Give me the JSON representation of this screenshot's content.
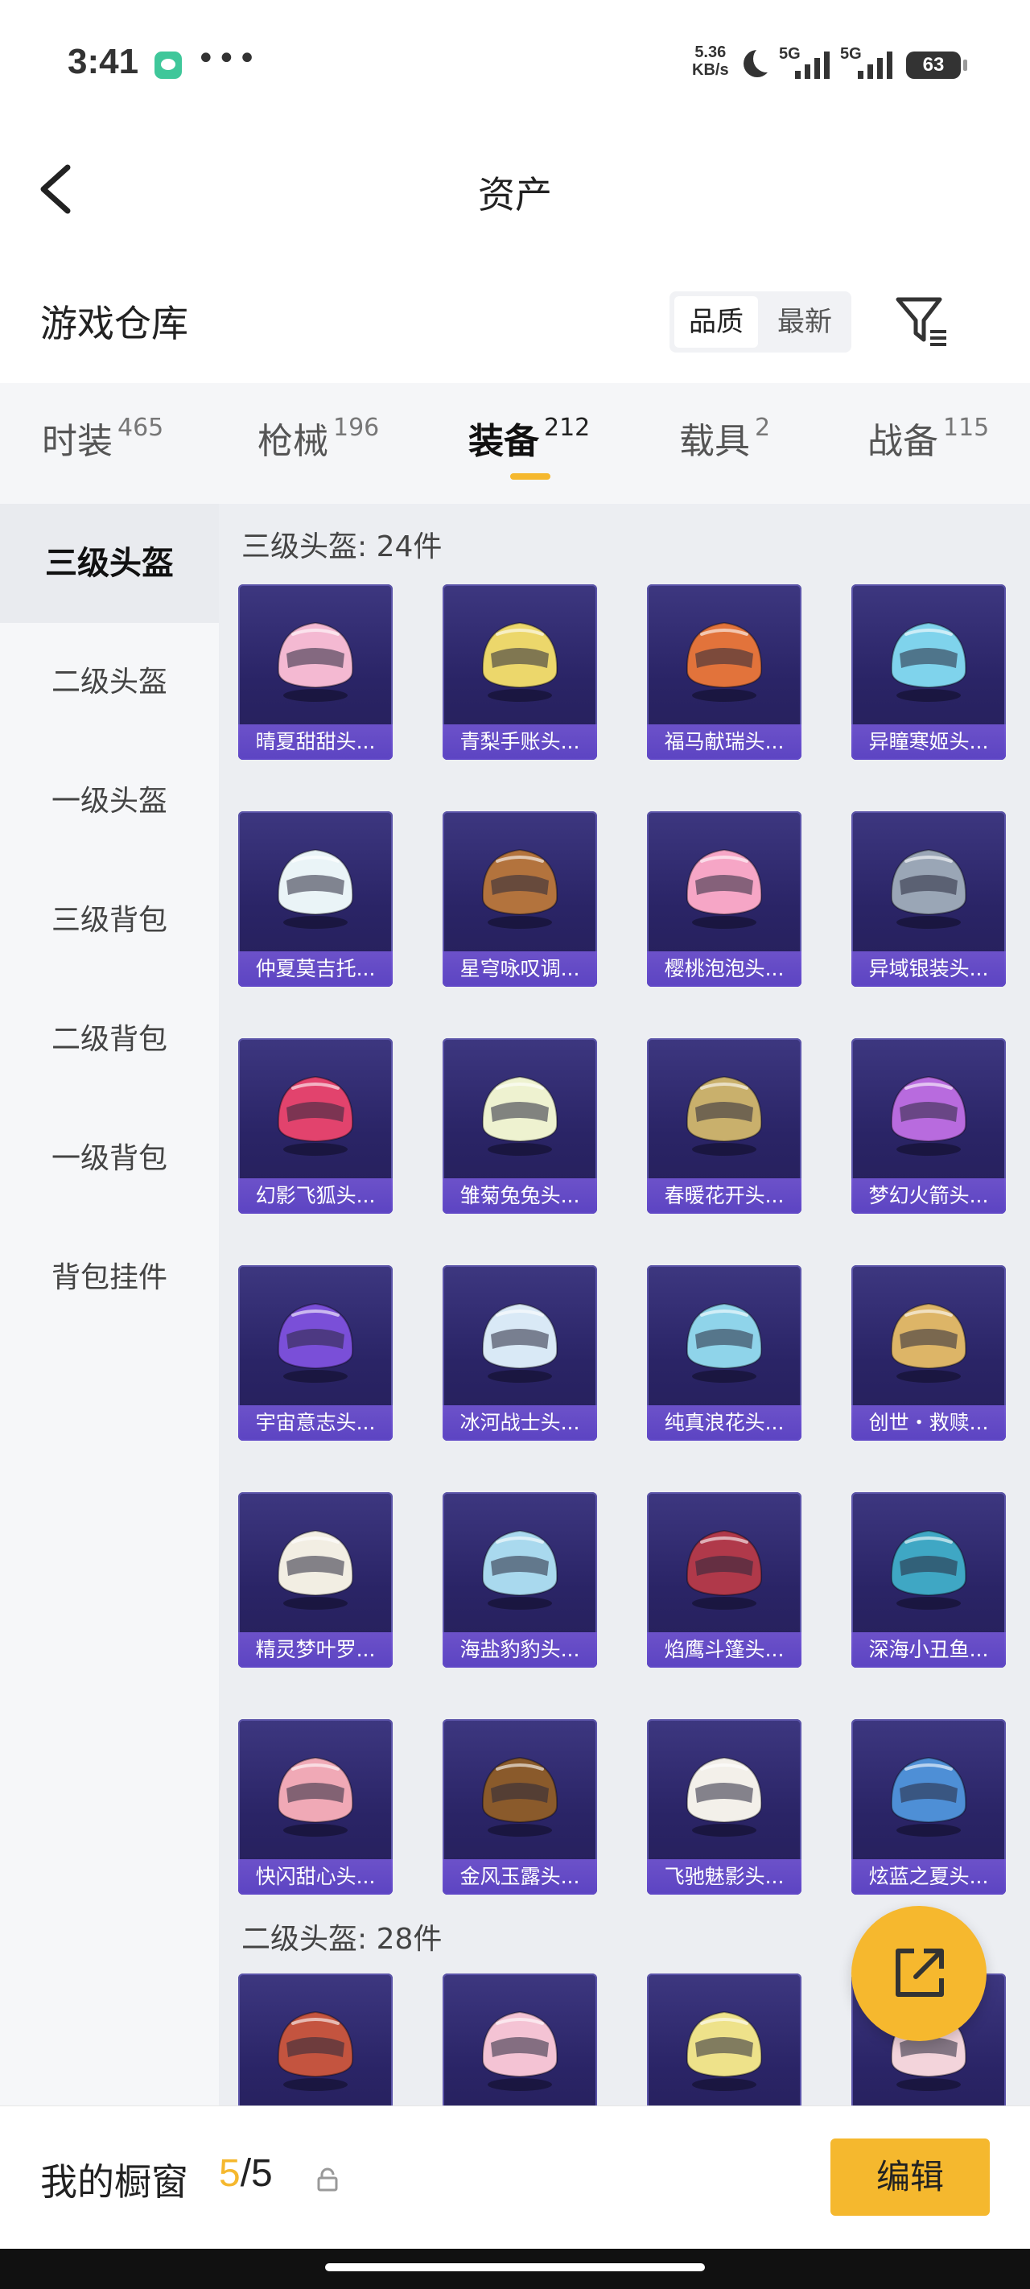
{
  "status_bar": {
    "time": "3:41",
    "net_speed_value": "5.36",
    "net_speed_unit": "KB/s",
    "sim1": "5G",
    "sim2": "5G",
    "battery": "63"
  },
  "header": {
    "title": "资产"
  },
  "warehouse": {
    "title": "游戏仓库",
    "sort_options": [
      "品质",
      "最新"
    ],
    "selected_sort": "品质"
  },
  "tabs": [
    {
      "label": "时装",
      "count": "465"
    },
    {
      "label": "枪械",
      "count": "196"
    },
    {
      "label": "装备",
      "count": "212",
      "active": true
    },
    {
      "label": "载具",
      "count": "2"
    },
    {
      "label": "战备",
      "count": "115"
    }
  ],
  "sidebar": [
    "三级头盔",
    "二级头盔",
    "一级头盔",
    "三级背包",
    "二级背包",
    "一级背包",
    "背包挂件"
  ],
  "sections": [
    {
      "title": "三级头盔: 24件",
      "items": [
        {
          "name": "晴夏甜甜头...",
          "color": "#f4b9d2"
        },
        {
          "name": "青梨手账头...",
          "color": "#ecd76b"
        },
        {
          "name": "福马献瑞头...",
          "color": "#e2733b"
        },
        {
          "name": "异瞳寒姬头...",
          "color": "#7fd3ec"
        },
        {
          "name": "仲夏莫吉托...",
          "color": "#eaf4f7"
        },
        {
          "name": "星穹咏叹调...",
          "color": "#b3733d"
        },
        {
          "name": "樱桃泡泡头...",
          "color": "#f6a6c6"
        },
        {
          "name": "异域银装头...",
          "color": "#9aa6b6"
        },
        {
          "name": "幻影飞狐头...",
          "color": "#e2436d"
        },
        {
          "name": "雏菊兔兔头...",
          "color": "#eef2d0"
        },
        {
          "name": "春暖花开头...",
          "color": "#c9b06c"
        },
        {
          "name": "梦幻火箭头...",
          "color": "#b86bde"
        },
        {
          "name": "宇宙意志头...",
          "color": "#7a4fd8"
        },
        {
          "name": "冰河战士头...",
          "color": "#d9e9f6"
        },
        {
          "name": "纯真浪花头...",
          "color": "#8fd4ea"
        },
        {
          "name": "创世・救赎...",
          "color": "#ddb567"
        },
        {
          "name": "精灵梦叶罗...",
          "color": "#f2eee3"
        },
        {
          "name": "海盐豹豹头...",
          "color": "#a9d9ee"
        },
        {
          "name": "焰鹰斗篷头...",
          "color": "#b0394a"
        },
        {
          "name": "深海小丑鱼...",
          "color": "#3fa7c4"
        },
        {
          "name": "快闪甜心头...",
          "color": "#f0a9b6"
        },
        {
          "name": "金风玉露头...",
          "color": "#8a5a2b"
        },
        {
          "name": "飞驰魅影头...",
          "color": "#f3f0ea"
        },
        {
          "name": "炫蓝之夏头...",
          "color": "#4e8fd6"
        }
      ]
    },
    {
      "title": "二级头盔: 28件",
      "items": [
        {
          "name": "",
          "color": "#c4543f"
        },
        {
          "name": "",
          "color": "#f4c3d4"
        },
        {
          "name": "",
          "color": "#eee28a"
        },
        {
          "name": "",
          "color": "#f3d4db"
        }
      ]
    }
  ],
  "showcase": {
    "label": "我的橱窗",
    "current": "5",
    "total": "/5"
  },
  "edit_label": "编辑"
}
